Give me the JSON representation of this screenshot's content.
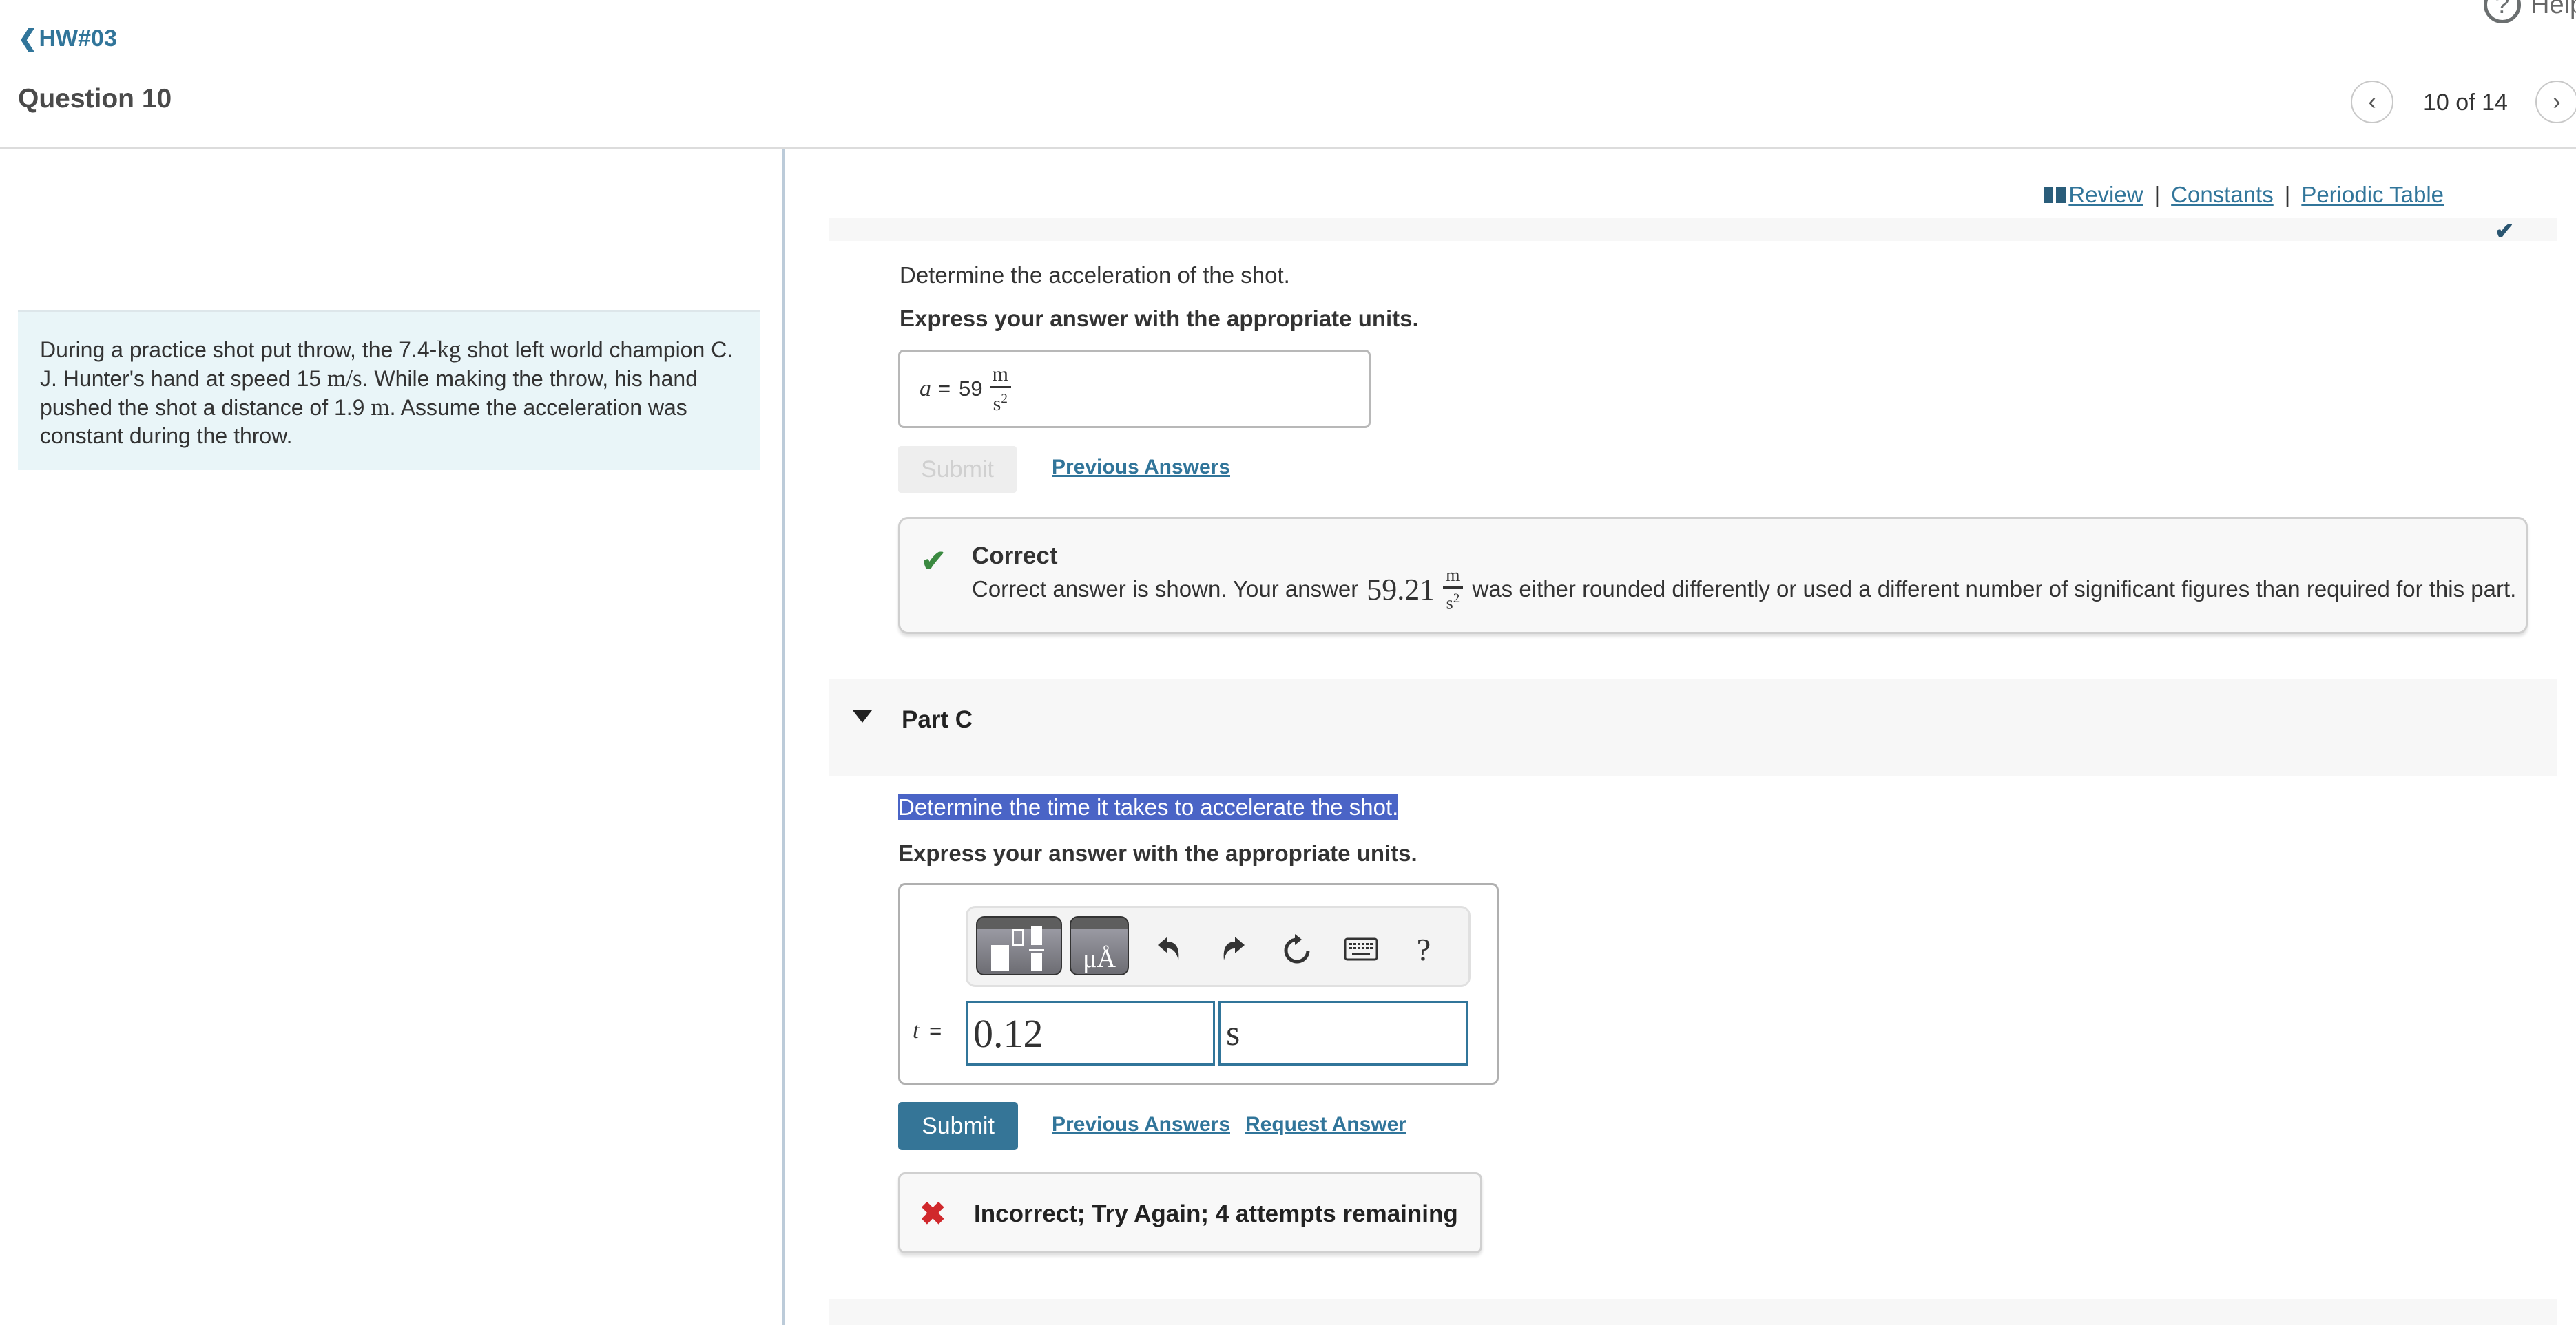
{
  "header": {
    "back_link": "HW#03",
    "question_title": "Question 10",
    "help_label": "Help",
    "pager": {
      "current": 10,
      "total": 14,
      "text": "10 of 14"
    }
  },
  "problem": {
    "text_parts": [
      "During a practice shot put throw, the ",
      "7.4-",
      "kg",
      " shot left world champion C. J. Hunter's hand at speed ",
      "15 ",
      "m/s",
      ". While making the throw, his hand pushed the shot a distance of ",
      "1.9 ",
      "m",
      ". Assume the acceleration was constant during the throw."
    ]
  },
  "resources": {
    "review": "Review",
    "constants": "Constants",
    "periodic_table": "Periodic Table",
    "separator": "|"
  },
  "part_b": {
    "prompt": "Determine the acceleration of the shot.",
    "instruction": "Express your answer with the appropriate units.",
    "answer": {
      "variable": "a",
      "equals": "=",
      "value": "59",
      "unit_num": "m",
      "unit_den": "s",
      "unit_den_exp": "2"
    },
    "submit_label": "Submit",
    "previous_answers_label": "Previous Answers",
    "feedback": {
      "status": "Correct",
      "body_before": "Correct answer is shown. Your answer",
      "user_value": "59.21",
      "unit_num": "m",
      "unit_den": "s",
      "unit_den_exp": "2",
      "body_after": "was either rounded differently or used a different number of significant figures than required for this part."
    }
  },
  "part_c": {
    "label": "Part C",
    "prompt": "Determine the time it takes to accelerate the shot.",
    "instruction": "Express your answer with the appropriate units.",
    "toolbar": {
      "units_glyph": "μÅ",
      "help_glyph": "?"
    },
    "variable": "t",
    "equals": "=",
    "value_input": "0.12",
    "unit_input": "s",
    "submit_label": "Submit",
    "previous_answers_label": "Previous Answers",
    "request_answer_label": "Request Answer",
    "feedback": {
      "status_text": "Incorrect; Try Again; 4 attempts remaining",
      "attempts_remaining": 4
    }
  },
  "colors": {
    "link": "#31759a",
    "submit_bg": "#357597",
    "correct_green": "#3b8a41",
    "incorrect_red": "#d0282c",
    "selection": "#4a64c6",
    "problem_bg": "#e9f5f8"
  }
}
